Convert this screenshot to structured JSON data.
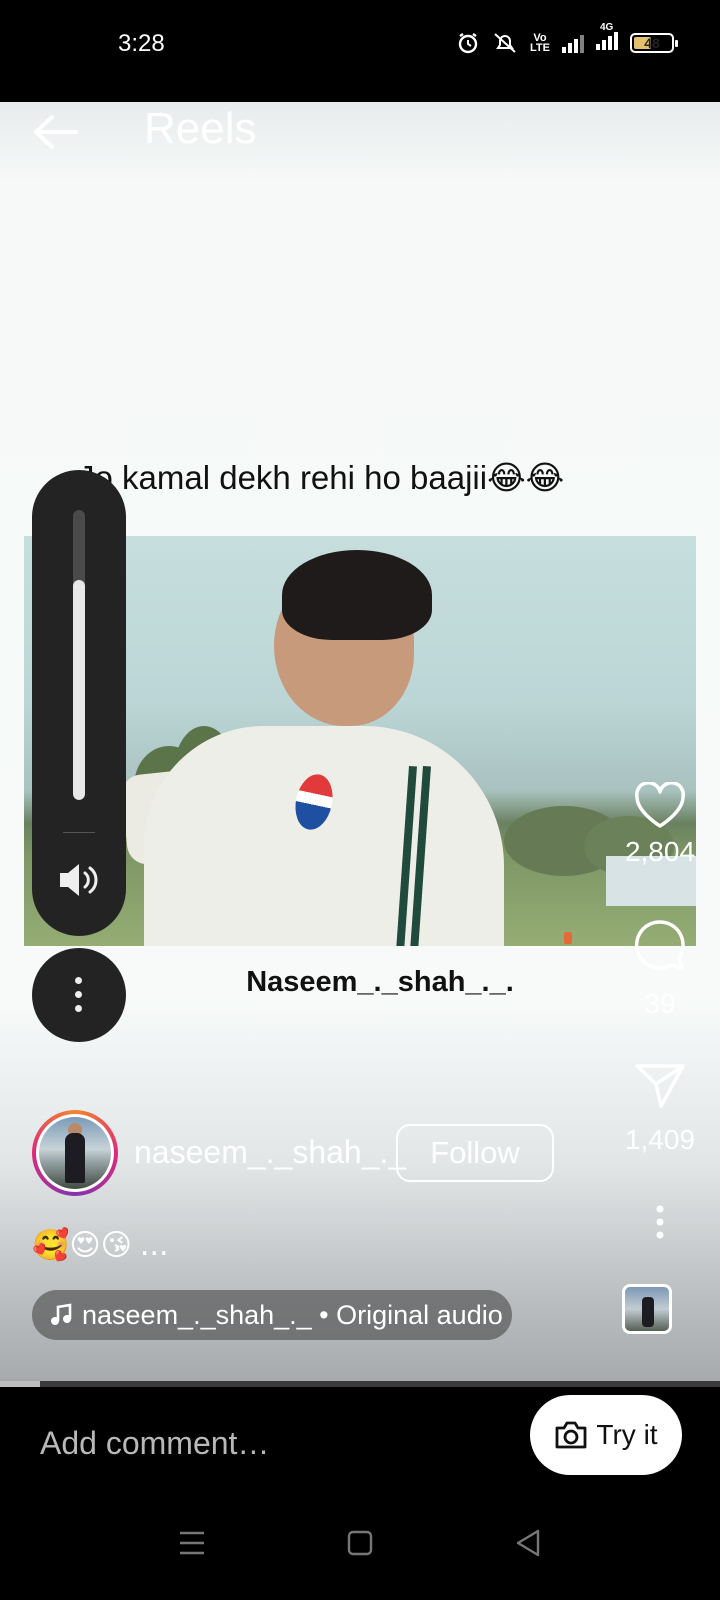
{
  "status_bar": {
    "time": "3:28",
    "net_top": "Vo",
    "net_bottom": "LTE",
    "network_type": "4G",
    "battery": "48",
    "battery_level": 0.48,
    "battery_color": "#e3c16f",
    "icons": [
      "alarm-icon",
      "silent-icon",
      "volte-icon",
      "signal-icon",
      "signal-4g-icon",
      "battery-icon"
    ]
  },
  "header": {
    "title": "Reels",
    "back_icon": "arrow-left-icon"
  },
  "reel": {
    "overlay_caption": "Jo kamal dekh rehi ho baajii😂😂",
    "video_caption": "Naseem_._shah_._.",
    "volume_level": 0.76
  },
  "actions": {
    "likes": "2,804",
    "comments": "39",
    "shares": "1,409"
  },
  "author": {
    "username": "naseem_._shah_._",
    "follow_label": "Follow",
    "caption": "🥰😍😘",
    "caption_more": "..."
  },
  "audio": {
    "label": "naseem_._shah_._ • Original audio"
  },
  "progress": 0.055,
  "comment_bar": {
    "placeholder": "Add comment…",
    "try_it_label": "Try it"
  },
  "colors": {
    "accent_ring": [
      "#f58529",
      "#dd2a7b",
      "#8134af"
    ],
    "panel": "#232323"
  }
}
